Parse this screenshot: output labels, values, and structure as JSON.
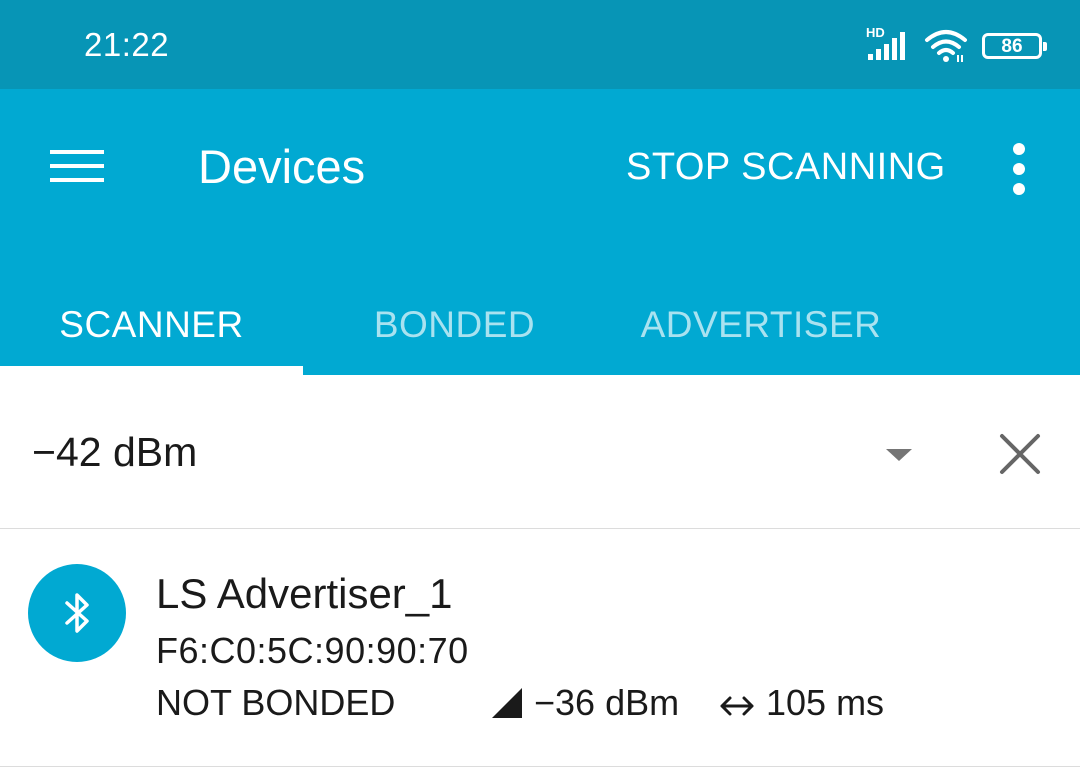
{
  "status_bar": {
    "time": "21:22",
    "network_label": "HD",
    "battery_level": "86",
    "icons": [
      "signal-icon",
      "wifi-icon",
      "battery-icon"
    ]
  },
  "app_bar": {
    "title": "Devices",
    "stop_scanning_label": "STOP SCANNING",
    "menu_icon": "hamburger-menu-icon",
    "overflow_icon": "more-vertical-icon"
  },
  "tabs": [
    {
      "label": "SCANNER",
      "active": true
    },
    {
      "label": "BONDED",
      "active": false
    },
    {
      "label": "ADVERTISER",
      "active": false
    }
  ],
  "filter": {
    "rssi_value": "−42 dBm",
    "dropdown_icon": "dropdown-arrow-icon",
    "clear_icon": "close-icon"
  },
  "devices": [
    {
      "name": "LS Advertiser_1",
      "address": "F6:C0:5C:90:90:70",
      "bond_state": "NOT BONDED",
      "rssi": "−36 dBm",
      "interval": "105 ms",
      "icon": "bluetooth-icon"
    }
  ],
  "colors": {
    "status_bar": "#0795b6",
    "primary": "#01a9d2",
    "inactive_tab": "#a9e2f0",
    "text": "#1a1a1a"
  }
}
